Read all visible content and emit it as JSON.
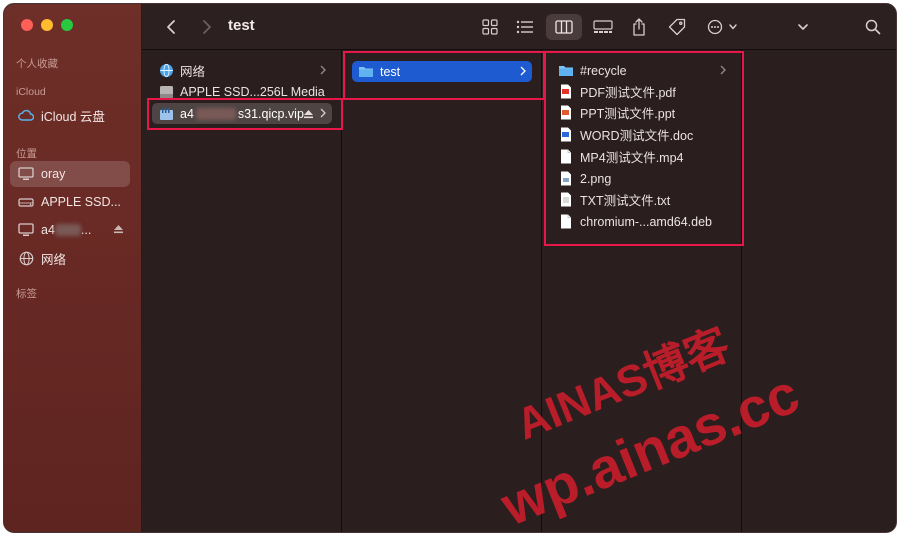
{
  "window": {
    "title": "test"
  },
  "sidebar": {
    "sections": {
      "favorites": "个人收藏",
      "icloud": "iCloud",
      "locations": "位置",
      "tags": "标签"
    },
    "items": [
      {
        "label": "iCloud 云盘",
        "icon": "cloud-icon"
      },
      {
        "label": "oray",
        "icon": "computer-icon",
        "selected": true
      },
      {
        "label": "APPLE SSD...",
        "icon": "drive-icon"
      },
      {
        "label_prefix": "a4",
        "label_suffix": "...",
        "icon": "server-icon"
      },
      {
        "label": "网络",
        "icon": "network-globe-icon"
      }
    ]
  },
  "columns": {
    "col1": [
      {
        "label": "网络",
        "icon": "network-globe-icon"
      },
      {
        "label": "APPLE SSD...256L Media",
        "icon": "drive-icon"
      },
      {
        "label_prefix": "a4",
        "label_suffix": "s31.qicp.vip",
        "icon": "server-icon"
      }
    ],
    "col2": [
      {
        "label": "test",
        "icon": "folder-icon"
      }
    ],
    "col3": [
      {
        "label": "#recycle",
        "icon": "folder-icon"
      },
      {
        "label": "PDF测试文件.pdf",
        "icon": "pdf-file-icon"
      },
      {
        "label": "PPT测试文件.ppt",
        "icon": "ppt-file-icon"
      },
      {
        "label": "WORD测试文件.doc",
        "icon": "word-file-icon"
      },
      {
        "label": "MP4测试文件.mp4",
        "icon": "file-icon"
      },
      {
        "label": "2.png",
        "icon": "image-file-icon"
      },
      {
        "label": "TXT测试文件.txt",
        "icon": "text-file-icon"
      },
      {
        "label": "chromium-...amd64.deb",
        "icon": "file-icon"
      }
    ]
  },
  "watermark": {
    "line1": "AINAS博客",
    "line2": "wp.ainas.cc"
  },
  "colors": {
    "accent_blue": "#1f5bd0",
    "highlight_red": "#e8174a",
    "sidebar_bg": "#6a2a25"
  }
}
